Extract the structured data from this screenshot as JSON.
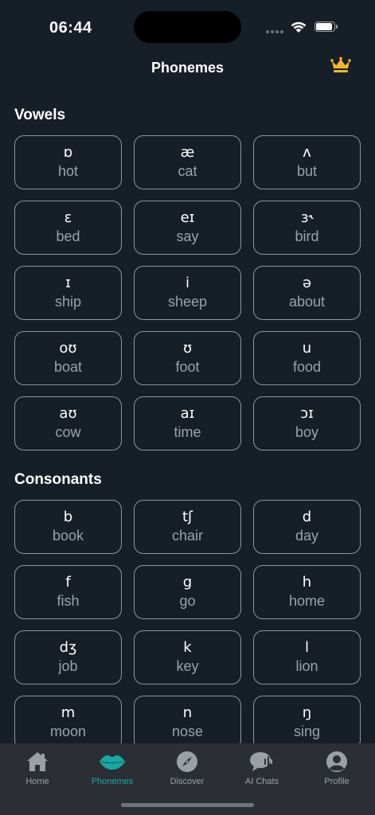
{
  "status": {
    "time": "06:44"
  },
  "header": {
    "title": "Phonemes"
  },
  "sections": {
    "vowels": {
      "title": "Vowels",
      "items": [
        {
          "symbol": "ɒ",
          "word": "hot"
        },
        {
          "symbol": "æ",
          "word": "cat"
        },
        {
          "symbol": "ʌ",
          "word": "but"
        },
        {
          "symbol": "ɛ",
          "word": "bed"
        },
        {
          "symbol": "eɪ",
          "word": "say"
        },
        {
          "symbol": "ɜ˞",
          "word": "bird"
        },
        {
          "symbol": "ɪ",
          "word": "ship"
        },
        {
          "symbol": "i",
          "word": "sheep"
        },
        {
          "symbol": "ə",
          "word": "about"
        },
        {
          "symbol": "oʊ",
          "word": "boat"
        },
        {
          "symbol": "ʊ",
          "word": "foot"
        },
        {
          "symbol": "u",
          "word": "food"
        },
        {
          "symbol": "aʊ",
          "word": "cow"
        },
        {
          "symbol": "aɪ",
          "word": "time"
        },
        {
          "symbol": "ɔɪ",
          "word": "boy"
        }
      ]
    },
    "consonants": {
      "title": "Consonants",
      "items": [
        {
          "symbol": "b",
          "word": "book"
        },
        {
          "symbol": "tʃ",
          "word": "chair"
        },
        {
          "symbol": "d",
          "word": "day"
        },
        {
          "symbol": "f",
          "word": "fish"
        },
        {
          "symbol": "g",
          "word": "go"
        },
        {
          "symbol": "h",
          "word": "home"
        },
        {
          "symbol": "dʒ",
          "word": "job"
        },
        {
          "symbol": "k",
          "word": "key"
        },
        {
          "symbol": "l",
          "word": "lion"
        },
        {
          "symbol": "m",
          "word": "moon"
        },
        {
          "symbol": "n",
          "word": "nose"
        },
        {
          "symbol": "ŋ",
          "word": "sing"
        }
      ]
    }
  },
  "tabs": [
    {
      "label": "Home",
      "icon": "home-icon",
      "active": false
    },
    {
      "label": "Phonemes",
      "icon": "lips-icon",
      "active": true
    },
    {
      "label": "Discover",
      "icon": "compass-icon",
      "active": false
    },
    {
      "label": "AI Chats",
      "icon": "chat-icon",
      "active": false
    },
    {
      "label": "Profile",
      "icon": "profile-icon",
      "active": false
    }
  ],
  "colors": {
    "background": "#161e27",
    "card_border": "#8d96a0",
    "tab_bar": "#2b2f35",
    "active_tab": "#1aa7a1",
    "crown": "#f5b62a"
  }
}
